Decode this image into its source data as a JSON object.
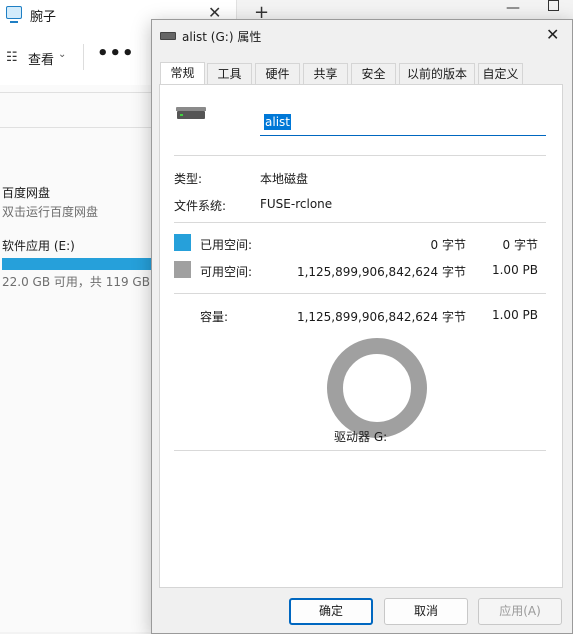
{
  "explorer": {
    "tab_title": "腕子",
    "close_symbol": "✕",
    "new_tab_symbol": "+",
    "view_label": "查看",
    "more_label": "•••",
    "drives": [
      {
        "title": "百度网盘",
        "subtitle": "双击运行百度网盘"
      },
      {
        "title": "软件应用 (E:)",
        "subtitle": "22.0 GB 可用，共 119 GB",
        "used_fraction": 0.815
      }
    ]
  },
  "dialog": {
    "title": "alist (G:) 属性",
    "tabs": [
      "常规",
      "工具",
      "硬件",
      "共享",
      "安全",
      "以前的版本",
      "自定义"
    ],
    "active_tab": "常规",
    "name_value": "alist",
    "type_label": "类型:",
    "type_value": "本地磁盘",
    "fs_label": "文件系统:",
    "fs_value": "FUSE-rclone",
    "used_label": "已用空间:",
    "used_bytes": "0 字节",
    "used_human": "0 字节",
    "free_label": "可用空间:",
    "free_bytes": "1,125,899,906,842,624 字节",
    "free_human": "1.00 PB",
    "capacity_label": "容量:",
    "capacity_bytes": "1,125,899,906,842,624 字节",
    "capacity_human": "1.00 PB",
    "drive_label": "驱动器 G:",
    "buttons": {
      "ok": "确定",
      "cancel": "取消",
      "apply": "应用(A)"
    },
    "colors": {
      "used": "#26a0da",
      "free": "#a0a0a0",
      "accent": "#0067c0"
    }
  }
}
